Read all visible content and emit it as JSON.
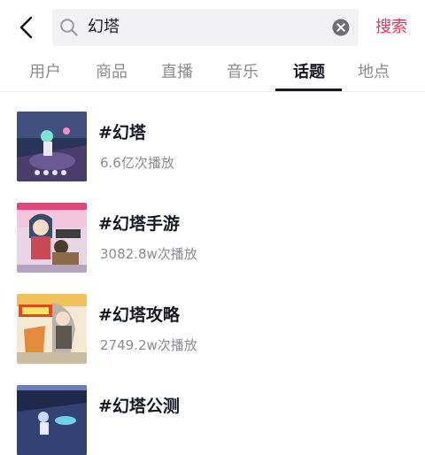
{
  "header": {
    "back_icon": "chevron-left-icon",
    "search": {
      "query": "幻塔",
      "icon": "search-icon",
      "clear_icon": "close-circle-icon"
    },
    "search_action": "搜索",
    "accent_color": "#fe2c55"
  },
  "tabs": [
    {
      "label": "用户",
      "active": false
    },
    {
      "label": "商品",
      "active": false
    },
    {
      "label": "直播",
      "active": false
    },
    {
      "label": "音乐",
      "active": false
    },
    {
      "label": "话题",
      "active": true
    },
    {
      "label": "地点",
      "active": false
    }
  ],
  "results": [
    {
      "title": "#幻塔",
      "plays": "6.6亿次播放"
    },
    {
      "title": "#幻塔手游",
      "plays": "3082.8w次播放"
    },
    {
      "title": "#幻塔攻略",
      "plays": "2749.2w次播放"
    },
    {
      "title": "#幻塔公测",
      "plays": ""
    }
  ]
}
